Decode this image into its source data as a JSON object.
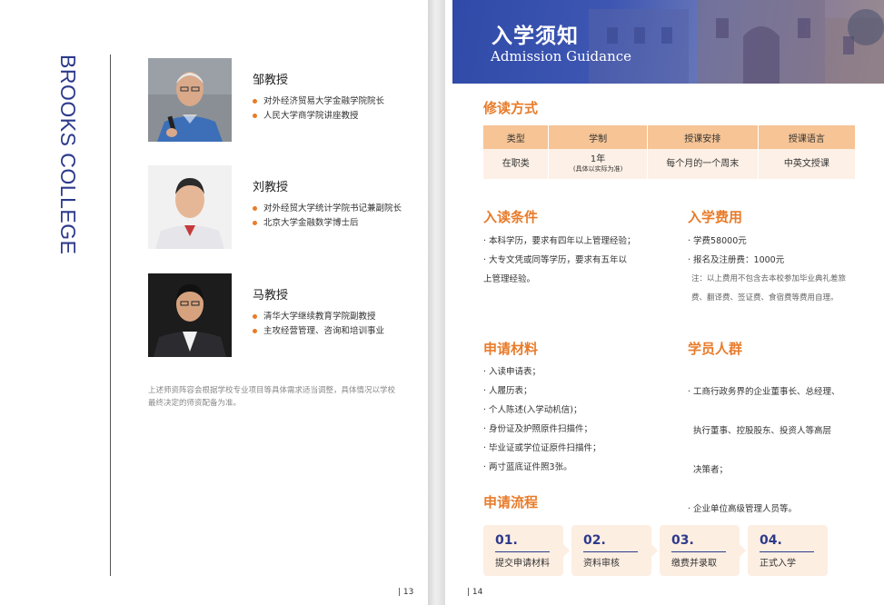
{
  "left_page": {
    "brand": "BROOKS COLLEGE",
    "professors": [
      {
        "name": "邹教授",
        "bullets": [
          "对外经济贸易大学金融学院院长",
          "人民大学商学院讲座教授"
        ]
      },
      {
        "name": "刘教授",
        "bullets": [
          "对外经贸大学统计学院书记兼副院长",
          "北京大学金融数学博士后"
        ]
      },
      {
        "name": "马教授",
        "bullets": [
          "清华大学继续教育学院副教授",
          "主攻经营管理、咨询和培训事业"
        ]
      }
    ],
    "note": "上述师资阵容会根据学校专业项目等具体需求适当调整，具体情况以学校最终决定的师资配备为准。",
    "page_number": "| 13"
  },
  "right_page": {
    "banner_title": "入学须知",
    "banner_subtitle": "Admission Guidance",
    "study_mode": {
      "heading": "修读方式",
      "headers": [
        "类型",
        "学制",
        "授课安排",
        "授课语言"
      ],
      "type": "在职类",
      "duration": "1年",
      "duration_note": "(具体以实际为准)",
      "schedule": "每个月的一个周末",
      "language": "中英文授课"
    },
    "requirements": {
      "heading": "入读条件",
      "items": [
        "· 本科学历，要求有四年以上管理经验；",
        "· 大专文凭或同等学历，要求有五年以",
        "  上管理经验。"
      ]
    },
    "fees": {
      "heading": "入学费用",
      "items": [
        "· 学费58000元",
        "· 报名及注册费：1000元"
      ],
      "note": "注：以上费用不包含去本校参加毕业典礼差旅费、翻译费、签证费、食宿费等费用自理。"
    },
    "materials": {
      "heading": "申请材料",
      "items": [
        "· 入读申请表；",
        "· 人履历表；",
        "· 个人陈述(入学动机信)；",
        "· 身份证及护照原件扫描件；",
        "· 毕业证或学位证原件扫描件；",
        "· 两寸蓝底证件照3张。"
      ]
    },
    "audience": {
      "heading": "学员人群",
      "items": [
        "· 工商行政务界的企业董事长、总经理、",
        "  执行董事、控股股东、投资人等高层",
        "  决策者；",
        "· 企业单位高级管理人员等。"
      ]
    },
    "process": {
      "heading": "申请流程",
      "steps": [
        {
          "num": "01.",
          "label": "提交申请材料"
        },
        {
          "num": "02.",
          "label": "资料审核"
        },
        {
          "num": "03.",
          "label": "缴费并录取"
        },
        {
          "num": "04.",
          "label": "正式入学"
        }
      ]
    },
    "page_number": "| 14"
  },
  "colors": {
    "accent": "#e87b2a",
    "brand_blue": "#2d3a8c",
    "table_header": "#f6c495",
    "table_cell": "#fdf0e6"
  }
}
